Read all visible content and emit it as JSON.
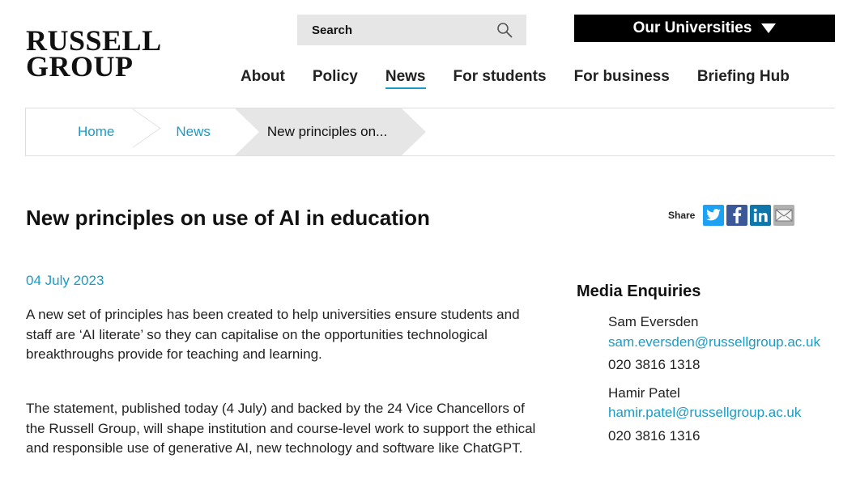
{
  "logo": {
    "line1": "RUSSELL",
    "line2": "GROUP"
  },
  "search": {
    "placeholder": "Search"
  },
  "universities_label": "Our Universities",
  "nav": {
    "about": "About",
    "policy": "Policy",
    "news": "News",
    "students": "For students",
    "business": "For business",
    "briefing": "Briefing Hub"
  },
  "breadcrumb": {
    "home": "Home",
    "news": "News",
    "current": "New principles on..."
  },
  "article": {
    "title": "New principles on use of AI in education",
    "date": "04 July 2023",
    "p1": "A new set of principles has been created to help universities ensure students and staff are ‘AI literate’ so they can capitalise on the opportunities technological breakthroughs provide for teaching and learning.",
    "p2": "The statement, published today (4 July) and backed by the 24 Vice Chancellors of the Russell Group, will shape institution and course-level work to support the ethical and responsible use of generative AI, new technology and software like ChatGPT."
  },
  "share": {
    "label": "Share"
  },
  "media": {
    "heading": "Media Enquiries",
    "contacts": [
      {
        "name": "Sam Eversden",
        "email": "sam.eversden@russellgroup.ac.uk",
        "phone": "020 3816 1318"
      },
      {
        "name": "Hamir Patel",
        "email": "hamir.patel@russellgroup.ac.uk",
        "phone": "020 3816 1316"
      }
    ]
  },
  "colors": {
    "accent": "#1a9bc6",
    "twitter": "#1da1f2",
    "facebook": "#3b5998",
    "linkedin": "#0e76a8",
    "email": "#b0b0b0"
  }
}
